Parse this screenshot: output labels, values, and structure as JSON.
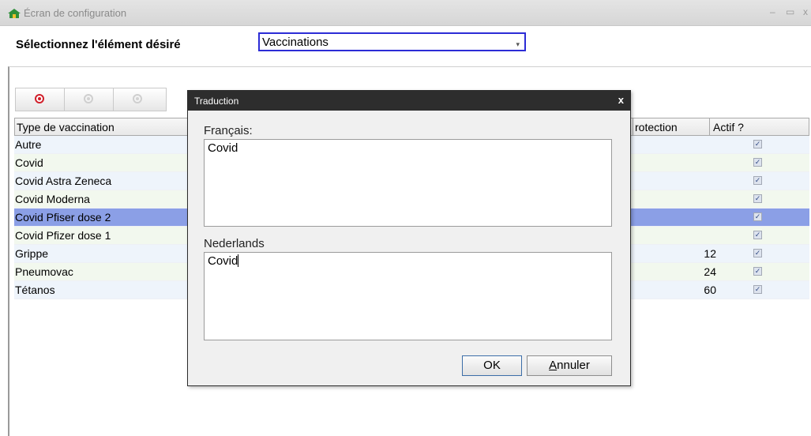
{
  "window": {
    "title": "Écran de configuration",
    "icon": "home-config-icon"
  },
  "selector": {
    "label": "Sélectionnez l'élément désiré",
    "value": "Vaccinations"
  },
  "toolbar": {
    "buttons": [
      {
        "icon": "add-record-icon",
        "state": "active"
      },
      {
        "icon": "edit-record-icon",
        "state": "disabled"
      },
      {
        "icon": "delete-record-icon",
        "state": "disabled"
      }
    ]
  },
  "grid": {
    "columns": [
      "Type de vaccination",
      "rotection",
      "Actif ?"
    ],
    "rows": [
      {
        "name": "Autre",
        "protection": "",
        "active": true
      },
      {
        "name": "Covid",
        "protection": "",
        "active": true
      },
      {
        "name": "Covid Astra Zeneca",
        "protection": "",
        "active": true
      },
      {
        "name": "Covid Moderna",
        "protection": "",
        "active": true
      },
      {
        "name": "Covid Pfiser dose 2",
        "protection": "",
        "active": true
      },
      {
        "name": "Covid Pfizer dose 1",
        "protection": "",
        "active": true
      },
      {
        "name": "Grippe",
        "protection": "12",
        "active": true
      },
      {
        "name": "Pneumovac",
        "protection": "24",
        "active": true
      },
      {
        "name": "Tétanos",
        "protection": "60",
        "active": true
      }
    ]
  },
  "dialog": {
    "title": "Traduction",
    "close_glyph": "x",
    "fr_label": "Français:",
    "fr_value": "Covid",
    "nl_label": "Nederlands",
    "nl_value": "Covid",
    "ok_label": "OK",
    "cancel_label": "Annuler"
  },
  "colors": {
    "selection": "#8b9fe6",
    "select_border": "#2c2cd6",
    "dialog_title": "#2d2d2d"
  }
}
